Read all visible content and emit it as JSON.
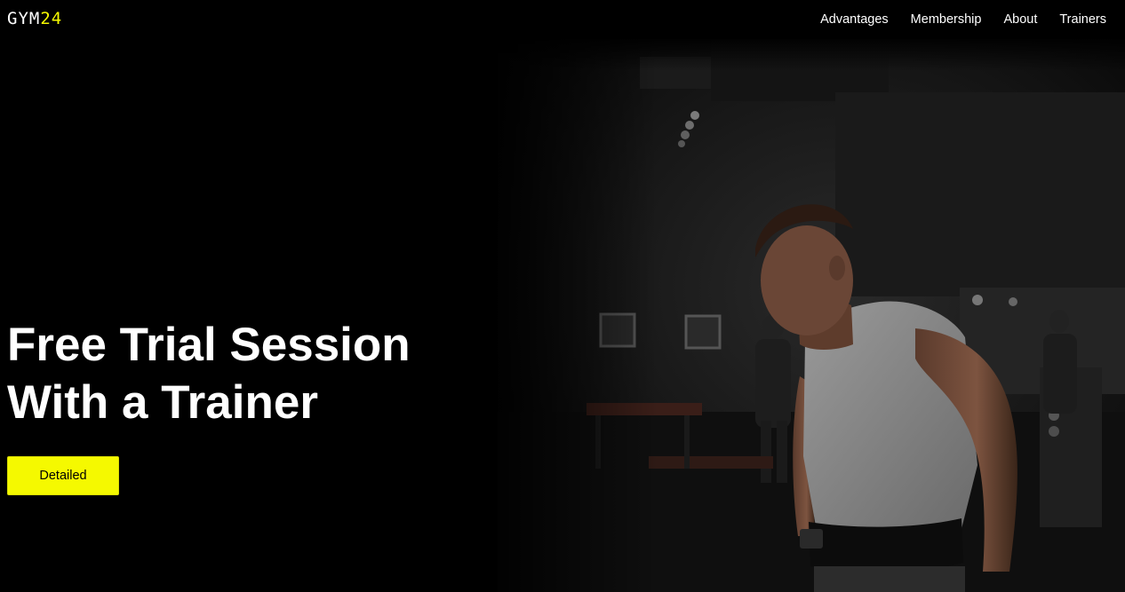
{
  "header": {
    "logo": {
      "text_main": "GYM",
      "text_accent": "24"
    },
    "nav": [
      {
        "label": "Advantages"
      },
      {
        "label": "Membership"
      },
      {
        "label": "About"
      },
      {
        "label": "Trainers"
      }
    ]
  },
  "hero": {
    "title_line_1": "Free Trial Session",
    "title_line_2": "With a Trainer",
    "cta_label": "Detailed",
    "image_subject": "trainer-photo"
  },
  "colors": {
    "background": "#000000",
    "accent": "#f5f900",
    "text": "#ffffff"
  }
}
